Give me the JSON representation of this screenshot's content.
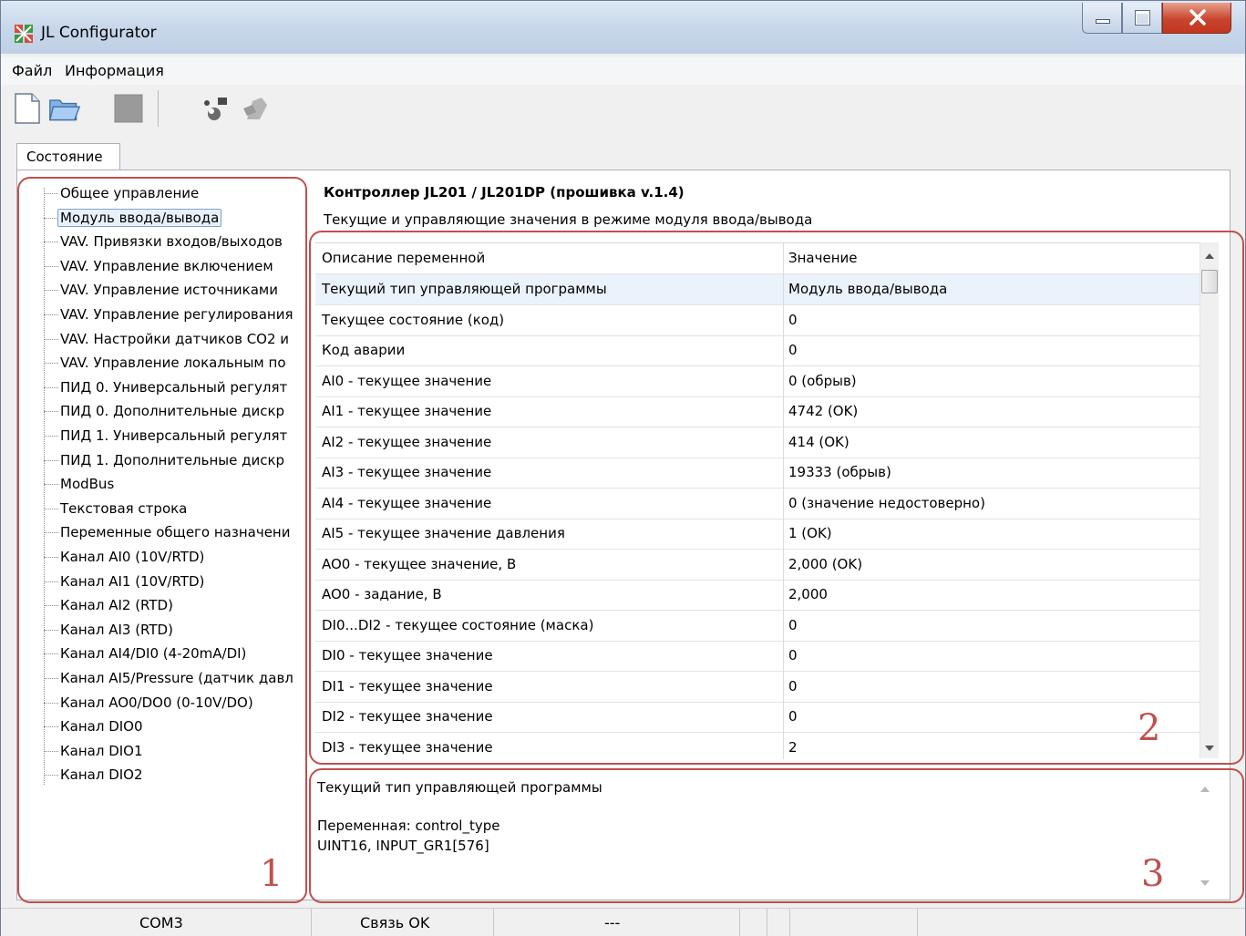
{
  "window": {
    "title": "JL Configurator"
  },
  "menu": [
    "Файл",
    "Информация"
  ],
  "tab": "Состояние",
  "tree": {
    "items": [
      "Общее управление",
      "Модуль ввода/вывода",
      "VAV. Привязки входов/выходов",
      "VAV. Управление включением",
      "VAV. Управление источниками",
      "VAV. Управление регулирования",
      "VAV. Настройки датчиков CO2 и",
      "VAV. Управление локальным по",
      "ПИД 0. Универсальный регулят",
      "ПИД 0. Дополнительные дискр",
      "ПИД 1. Универсальный регулят",
      "ПИД 1. Дополнительные дискр",
      "ModBus",
      "Текстовая строка",
      "Переменные общего назначени",
      "Канал AI0 (10V/RTD)",
      "Канал AI1 (10V/RTD)",
      "Канал AI2 (RTD)",
      "Канал AI3 (RTD)",
      "Канал AI4/DI0 (4-20mA/DI)",
      "Канал AI5/Pressure (датчик давл",
      "Канал AO0/DO0 (0-10V/DO)",
      "Канал DIO0",
      "Канал DIO1",
      "Канал DIO2"
    ],
    "selected_index": 1
  },
  "header": {
    "title": "Контроллер JL201 / JL201DP (прошивка v.1.4)",
    "subtitle": "Текущие и управляющие значения в режиме модуля ввода/вывода"
  },
  "grid": {
    "columns": [
      "Описание переменной",
      "Значение"
    ],
    "rows": [
      [
        "Текущий тип управляющей программы",
        "Модуль ввода/вывода"
      ],
      [
        "Текущее состояние (код)",
        "0"
      ],
      [
        "Код аварии",
        "0"
      ],
      [
        "AI0 - текущее значение",
        "0 (обрыв)"
      ],
      [
        "AI1 - текущее значение",
        "4742 (OK)"
      ],
      [
        "AI2 - текущее значение",
        "414 (OK)"
      ],
      [
        "AI3 - текущее значение",
        "19333 (обрыв)"
      ],
      [
        "AI4 - текущее значение",
        "0 (значение недостоверно)"
      ],
      [
        "AI5 - текущее значение давления",
        "1 (OK)"
      ],
      [
        "AO0 - текущее значение, В",
        "2,000 (OK)"
      ],
      [
        "AO0 - задание, В",
        "2,000"
      ],
      [
        "DI0...DI2 - текущее состояние (маска)",
        "0"
      ],
      [
        "DI0 - текущее значение",
        "0"
      ],
      [
        "DI1 - текущее значение",
        "0"
      ],
      [
        "DI2 - текущее значение",
        "0"
      ],
      [
        "DI3 - текущее значение",
        "2"
      ]
    ],
    "selected_index": 0
  },
  "description": {
    "title": "Текущий тип управляющей программы",
    "variable": "Переменная: control_type",
    "type": "UINT16, INPUT_GR1[576]"
  },
  "annotations": [
    "1",
    "2",
    "3"
  ],
  "status": {
    "port": "COM3",
    "link": "Связь OK",
    "extra": "---"
  },
  "colors": {
    "annotation": "#c0504d",
    "selection": "#eaf2fc",
    "close_button": "#c9452e"
  }
}
